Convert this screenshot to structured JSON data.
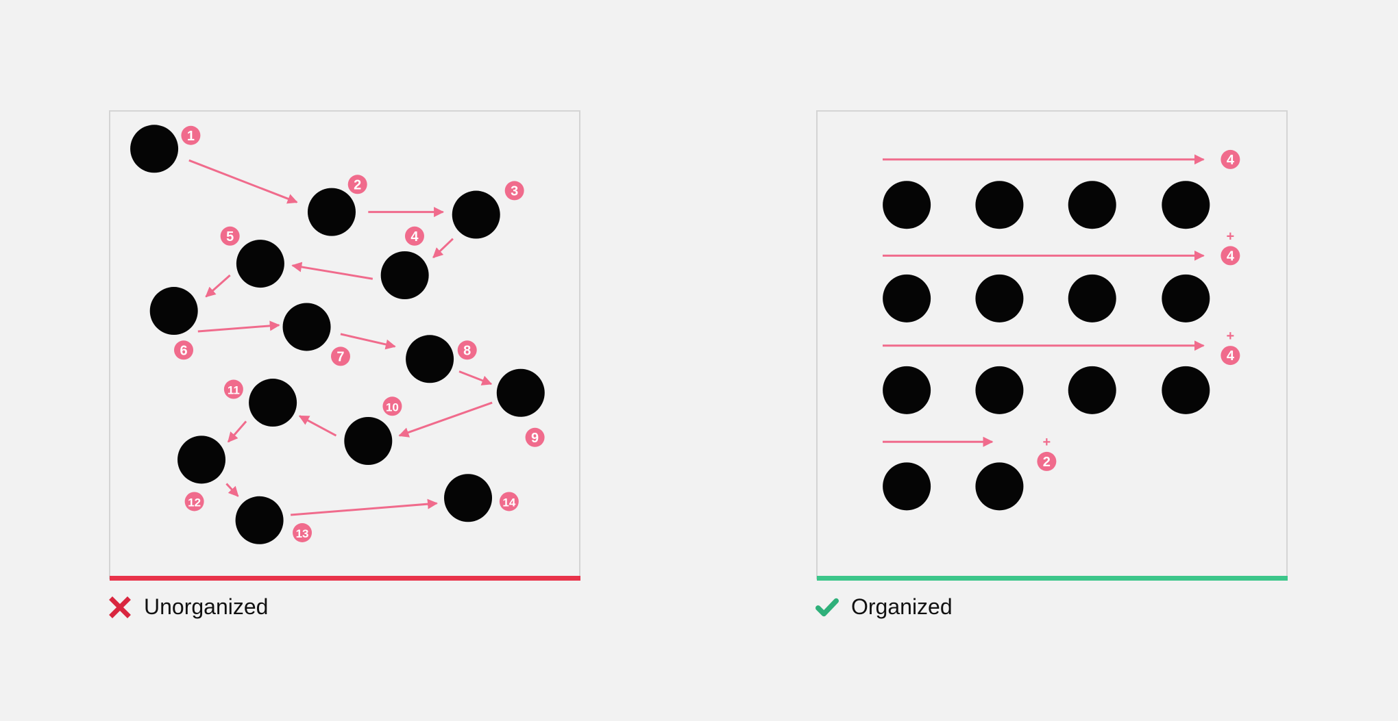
{
  "colors": {
    "background": "#f2f2f2",
    "panel_border": "#d4d4d4",
    "dot": "#050505",
    "accent_pink": "#f06b8c",
    "bad": "#e8334a",
    "good": "#3cc68a"
  },
  "left_panel": {
    "caption": "Unorganized",
    "status_icon": "cross-icon",
    "steps": [
      {
        "label": "1"
      },
      {
        "label": "2"
      },
      {
        "label": "3"
      },
      {
        "label": "4"
      },
      {
        "label": "5"
      },
      {
        "label": "6"
      },
      {
        "label": "7"
      },
      {
        "label": "8"
      },
      {
        "label": "9"
      },
      {
        "label": "10"
      },
      {
        "label": "11"
      },
      {
        "label": "12"
      },
      {
        "label": "13"
      },
      {
        "label": "14"
      }
    ]
  },
  "right_panel": {
    "caption": "Organized",
    "status_icon": "check-icon",
    "rows": [
      {
        "count": 4,
        "label": "4",
        "plus": false
      },
      {
        "count": 4,
        "label": "4",
        "plus": true
      },
      {
        "count": 4,
        "label": "4",
        "plus": true
      },
      {
        "count": 2,
        "label": "2",
        "plus": true
      }
    ],
    "plus_symbol": "+"
  }
}
